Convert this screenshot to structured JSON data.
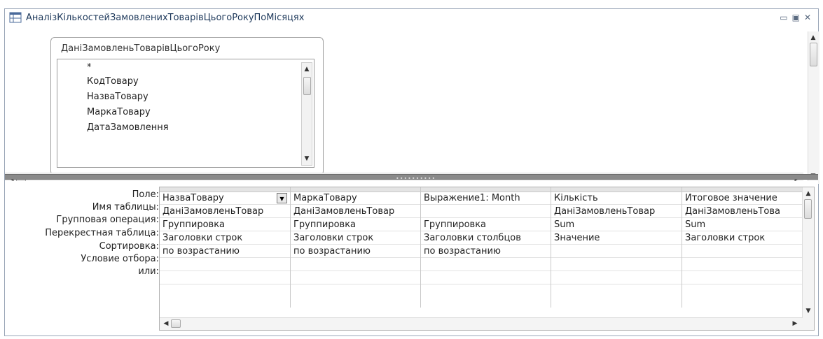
{
  "window": {
    "title": "АналізКількостейЗамовленихТоварівЦьогоРокуПоМісяцях",
    "controls": [
      "minimize",
      "restore",
      "close"
    ]
  },
  "table_box": {
    "title": "ДаніЗамовленьТоварівЦьогоРоку",
    "fields": [
      "*",
      "КодТовару",
      "НазваТовару",
      "МаркаТовару",
      "ДатаЗамовлення"
    ]
  },
  "grid": {
    "row_labels": [
      "Поле:",
      "Имя таблицы:",
      "Групповая операция:",
      "Перекрестная таблица:",
      "Сортировка:",
      "Условие отбора:",
      "или:"
    ],
    "columns": [
      {
        "field": "НазваТовару",
        "table": "ДаніЗамовленьТовар",
        "group": "Группировка",
        "crosstab": "Заголовки строк",
        "sort": "по возрастанию"
      },
      {
        "field": "МаркаТовару",
        "table": "ДаніЗамовленьТовар",
        "group": "Группировка",
        "crosstab": "Заголовки строк",
        "sort": "по возрастанию"
      },
      {
        "field": "Выражение1: Month",
        "table": "",
        "group": "Группировка",
        "crosstab": "Заголовки столбцов",
        "sort": "по возрастанию"
      },
      {
        "field": "Кількість",
        "table": "ДаніЗамовленьТовар",
        "group": "Sum",
        "crosstab": "Значение",
        "sort": ""
      },
      {
        "field": "Итоговое значение",
        "table": "ДаніЗамовленьТова",
        "group": "Sum",
        "crosstab": "Заголовки строк",
        "sort": ""
      }
    ]
  }
}
